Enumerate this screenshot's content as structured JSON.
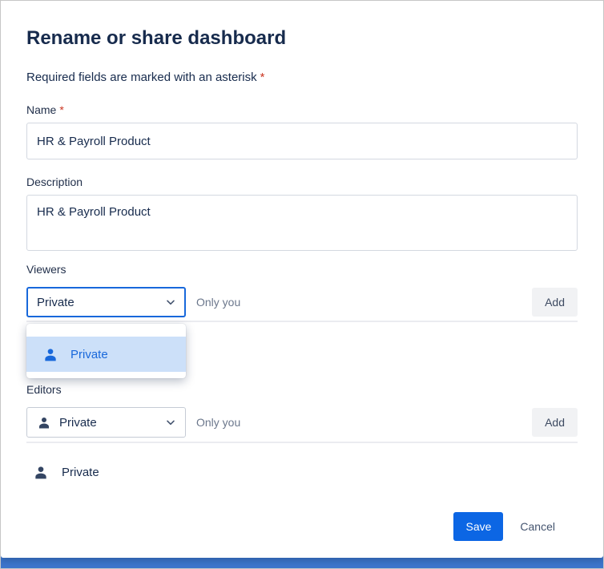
{
  "colors": {
    "primary": "#0C66E4",
    "focus_border": "#1868DB",
    "selected_option_bg": "#CCE0F9",
    "selected_option_text": "#1868DB",
    "required": "#CA3521",
    "backdrop": "#3D76CC"
  },
  "icons": {
    "person": "person-icon",
    "chevron_down": "chevron-down-icon"
  },
  "dialog": {
    "title": "Rename or share dashboard",
    "required_note": "Required fields are marked with an asterisk",
    "required_marker": "*",
    "name": {
      "label": "Name",
      "value": "HR & Payroll Product"
    },
    "description": {
      "label": "Description",
      "value": "HR & Payroll Product"
    },
    "viewers": {
      "label": "Viewers",
      "selected": "Private",
      "hint": "Only you",
      "add_button": "Add",
      "dropdown_options": [
        {
          "label": "Private"
        }
      ]
    },
    "editors": {
      "label": "Editors",
      "selected": "Private",
      "hint": "Only you",
      "add_button": "Add",
      "shared_with": [
        {
          "label": "Private"
        }
      ]
    },
    "footer": {
      "save": "Save",
      "cancel": "Cancel"
    }
  }
}
